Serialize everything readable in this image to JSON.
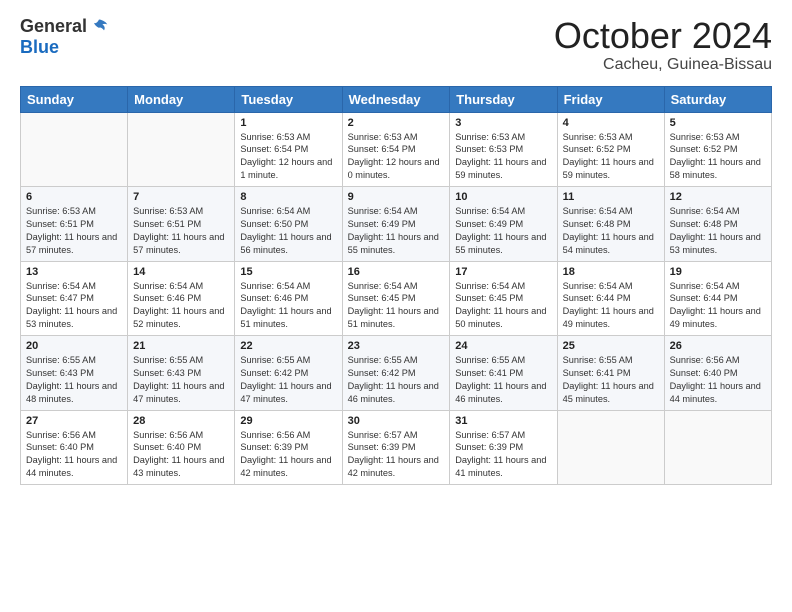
{
  "logo": {
    "general": "General",
    "blue": "Blue"
  },
  "title": "October 2024",
  "location": "Cacheu, Guinea-Bissau",
  "headers": [
    "Sunday",
    "Monday",
    "Tuesday",
    "Wednesday",
    "Thursday",
    "Friday",
    "Saturday"
  ],
  "weeks": [
    [
      {
        "day": "",
        "info": ""
      },
      {
        "day": "",
        "info": ""
      },
      {
        "day": "1",
        "info": "Sunrise: 6:53 AM\nSunset: 6:54 PM\nDaylight: 12 hours and 1 minute."
      },
      {
        "day": "2",
        "info": "Sunrise: 6:53 AM\nSunset: 6:54 PM\nDaylight: 12 hours and 0 minutes."
      },
      {
        "day": "3",
        "info": "Sunrise: 6:53 AM\nSunset: 6:53 PM\nDaylight: 11 hours and 59 minutes."
      },
      {
        "day": "4",
        "info": "Sunrise: 6:53 AM\nSunset: 6:52 PM\nDaylight: 11 hours and 59 minutes."
      },
      {
        "day": "5",
        "info": "Sunrise: 6:53 AM\nSunset: 6:52 PM\nDaylight: 11 hours and 58 minutes."
      }
    ],
    [
      {
        "day": "6",
        "info": "Sunrise: 6:53 AM\nSunset: 6:51 PM\nDaylight: 11 hours and 57 minutes."
      },
      {
        "day": "7",
        "info": "Sunrise: 6:53 AM\nSunset: 6:51 PM\nDaylight: 11 hours and 57 minutes."
      },
      {
        "day": "8",
        "info": "Sunrise: 6:54 AM\nSunset: 6:50 PM\nDaylight: 11 hours and 56 minutes."
      },
      {
        "day": "9",
        "info": "Sunrise: 6:54 AM\nSunset: 6:49 PM\nDaylight: 11 hours and 55 minutes."
      },
      {
        "day": "10",
        "info": "Sunrise: 6:54 AM\nSunset: 6:49 PM\nDaylight: 11 hours and 55 minutes."
      },
      {
        "day": "11",
        "info": "Sunrise: 6:54 AM\nSunset: 6:48 PM\nDaylight: 11 hours and 54 minutes."
      },
      {
        "day": "12",
        "info": "Sunrise: 6:54 AM\nSunset: 6:48 PM\nDaylight: 11 hours and 53 minutes."
      }
    ],
    [
      {
        "day": "13",
        "info": "Sunrise: 6:54 AM\nSunset: 6:47 PM\nDaylight: 11 hours and 53 minutes."
      },
      {
        "day": "14",
        "info": "Sunrise: 6:54 AM\nSunset: 6:46 PM\nDaylight: 11 hours and 52 minutes."
      },
      {
        "day": "15",
        "info": "Sunrise: 6:54 AM\nSunset: 6:46 PM\nDaylight: 11 hours and 51 minutes."
      },
      {
        "day": "16",
        "info": "Sunrise: 6:54 AM\nSunset: 6:45 PM\nDaylight: 11 hours and 51 minutes."
      },
      {
        "day": "17",
        "info": "Sunrise: 6:54 AM\nSunset: 6:45 PM\nDaylight: 11 hours and 50 minutes."
      },
      {
        "day": "18",
        "info": "Sunrise: 6:54 AM\nSunset: 6:44 PM\nDaylight: 11 hours and 49 minutes."
      },
      {
        "day": "19",
        "info": "Sunrise: 6:54 AM\nSunset: 6:44 PM\nDaylight: 11 hours and 49 minutes."
      }
    ],
    [
      {
        "day": "20",
        "info": "Sunrise: 6:55 AM\nSunset: 6:43 PM\nDaylight: 11 hours and 48 minutes."
      },
      {
        "day": "21",
        "info": "Sunrise: 6:55 AM\nSunset: 6:43 PM\nDaylight: 11 hours and 47 minutes."
      },
      {
        "day": "22",
        "info": "Sunrise: 6:55 AM\nSunset: 6:42 PM\nDaylight: 11 hours and 47 minutes."
      },
      {
        "day": "23",
        "info": "Sunrise: 6:55 AM\nSunset: 6:42 PM\nDaylight: 11 hours and 46 minutes."
      },
      {
        "day": "24",
        "info": "Sunrise: 6:55 AM\nSunset: 6:41 PM\nDaylight: 11 hours and 46 minutes."
      },
      {
        "day": "25",
        "info": "Sunrise: 6:55 AM\nSunset: 6:41 PM\nDaylight: 11 hours and 45 minutes."
      },
      {
        "day": "26",
        "info": "Sunrise: 6:56 AM\nSunset: 6:40 PM\nDaylight: 11 hours and 44 minutes."
      }
    ],
    [
      {
        "day": "27",
        "info": "Sunrise: 6:56 AM\nSunset: 6:40 PM\nDaylight: 11 hours and 44 minutes."
      },
      {
        "day": "28",
        "info": "Sunrise: 6:56 AM\nSunset: 6:40 PM\nDaylight: 11 hours and 43 minutes."
      },
      {
        "day": "29",
        "info": "Sunrise: 6:56 AM\nSunset: 6:39 PM\nDaylight: 11 hours and 42 minutes."
      },
      {
        "day": "30",
        "info": "Sunrise: 6:57 AM\nSunset: 6:39 PM\nDaylight: 11 hours and 42 minutes."
      },
      {
        "day": "31",
        "info": "Sunrise: 6:57 AM\nSunset: 6:39 PM\nDaylight: 11 hours and 41 minutes."
      },
      {
        "day": "",
        "info": ""
      },
      {
        "day": "",
        "info": ""
      }
    ]
  ]
}
